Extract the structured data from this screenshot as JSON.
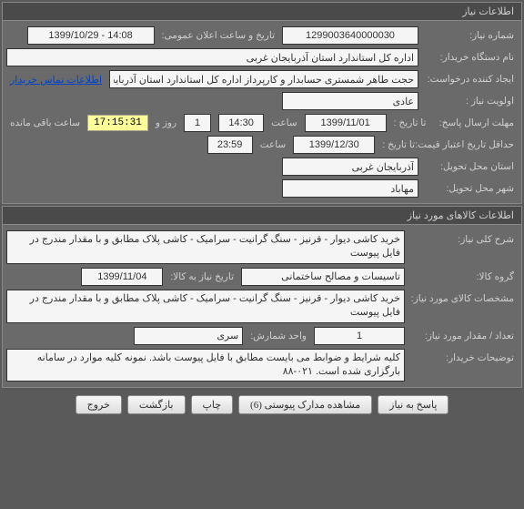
{
  "panel1": {
    "title": "اطلاعات نیاز",
    "rows": {
      "need_number_label": "شماره نیاز:",
      "need_number": "1299003640000030",
      "announce_label": "تاریخ و ساعت اعلان عمومی:",
      "announce_value": "1399/10/29 - 14:08",
      "buyer_org_label": "نام دستگاه خریدار:",
      "buyer_org": "اداره کل استاندارد استان آذربایجان غربی",
      "requester_label": "ایجاد کننده درخواست:",
      "requester": "حجت طاهر شمستری حسابدار و کارپرداز اداره کل استاندارد استان آذربایجان غربی",
      "contact_link": "اطلاعات تماس خریدار",
      "priority_label": "اولویت نیاز :",
      "priority": "عادی",
      "deadline_label": "مهلت ارسال پاسخ:",
      "until_date_label": "تا تاریخ :",
      "deadline_date": "1399/11/01",
      "time_label": "ساعت",
      "deadline_time": "14:30",
      "days": "1",
      "days_label": "روز و",
      "countdown": "17:15:31",
      "remaining_label": "ساعت باقی مانده",
      "min_credit_label": "حداقل تاریخ اعتبار قیمت:",
      "until_date_label2": "تا تاریخ :",
      "credit_date": "1399/12/30",
      "credit_time": "23:59",
      "province_label": "استان محل تحویل:",
      "province": "آذربایجان غربی",
      "city_label": "شهر محل تحویل:",
      "city": "مهاباد"
    }
  },
  "panel2": {
    "title": "اطلاعات کالاهای مورد نیاز",
    "rows": {
      "desc_label": "شرح کلی نیاز:",
      "desc": "خرید کاشی دیوار - قرنیز - سنگ گرانیت - سرامیک - کاشی پلاک مطابق و با مقدار مندرج در فایل پیوست",
      "group_label": "گروه کالا:",
      "group": "تاسیسات و مصالح ساختمانی",
      "need_to_label": "تاریخ نیاز به کالا:",
      "need_to": "1399/11/04",
      "spec_label": "مشخصات کالای مورد نیاز:",
      "spec": "خرید کاشی دیوار - قرنیز - سنگ گرانیت - سرامیک - کاشی پلاک مطابق و با مقدار مندرج در فایل پیوست",
      "qty_label": "تعداد / مقدار مورد نیاز:",
      "qty": "1",
      "unit_label": "واحد شمارش:",
      "unit": "سری",
      "notes_label": "توضیحات خریدار:",
      "notes": "کلیه شرایط و ضوابط می بایست مطابق با فایل پیوست باشد. نمونه کلیه موارد در سامانه بارگزاری شده است. ۰۲۱-۸۸"
    }
  },
  "buttons": {
    "respond": "پاسخ به نیاز",
    "attachments": "مشاهده مدارک پیوستی (6)",
    "print": "چاپ",
    "back": "بازگشت",
    "exit": "خروج"
  }
}
